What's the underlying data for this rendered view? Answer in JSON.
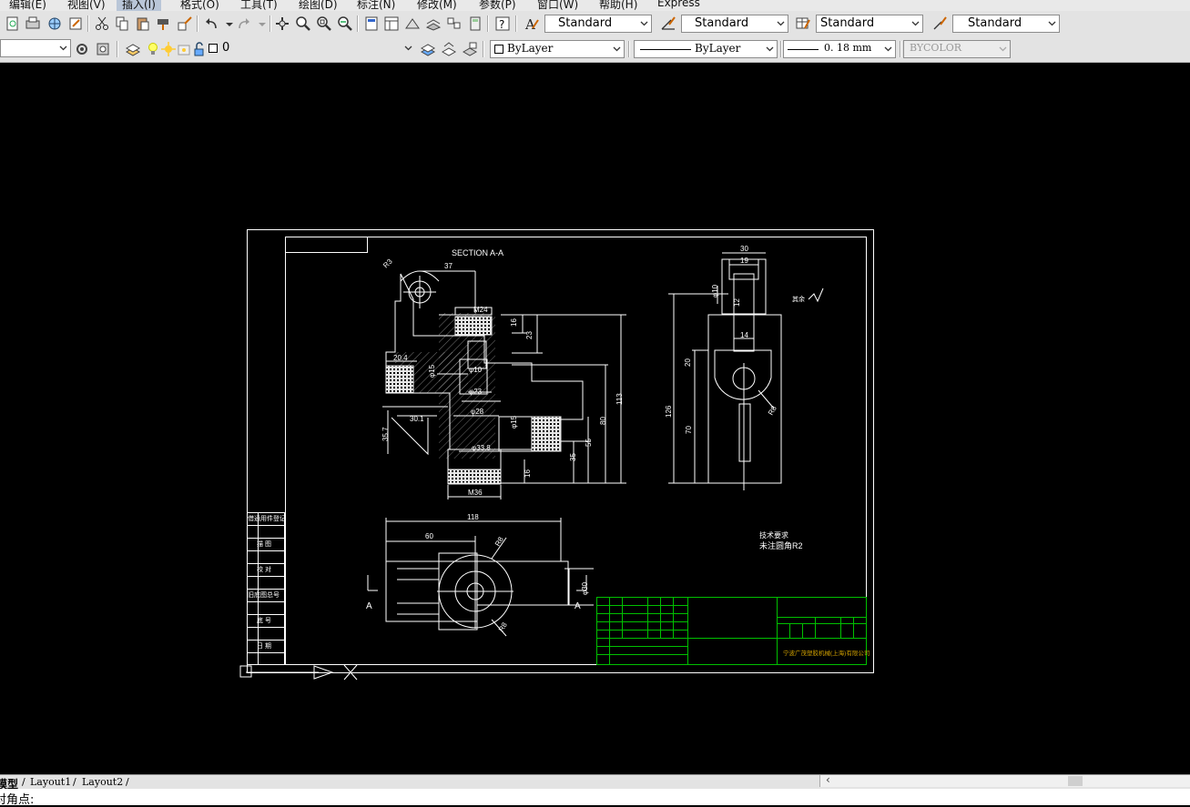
{
  "menu": {
    "items": [
      "编辑(E)",
      "视图(V)",
      "插入(I)",
      "格式(O)",
      "工具(T)",
      "绘图(D)",
      "标注(N)",
      "修改(M)",
      "参数(P)",
      "窗口(W)",
      "帮助(H)",
      "Express"
    ],
    "active": "插入(I)"
  },
  "styles_toolbar": {
    "text_style": "Standard",
    "dim_style": "Standard",
    "table_style": "Standard",
    "multileader_style": "Standard"
  },
  "layers_toolbar": {
    "layer_name": "0",
    "color": "ByLayer",
    "linetype": "ByLayer",
    "lineweight": "0. 18  mm",
    "plot_style": "BYCOLOR"
  },
  "drawing": {
    "section_title": "SECTION A-A",
    "dims_front": [
      "R3",
      "37",
      "M24",
      "16",
      "23",
      "20.4",
      "φ15",
      "φ10",
      "φ23",
      "φ28",
      "30.1",
      "φ15",
      "φ33.8",
      "35.7",
      "M36",
      "16",
      "35",
      "55",
      "80",
      "113"
    ],
    "dims_side": [
      "30",
      "19",
      "φ10",
      "12",
      "14",
      "20",
      "126",
      "70",
      "R8"
    ],
    "dims_top": [
      "118",
      "60",
      "R8",
      "φ30",
      "R8"
    ],
    "section_marks": [
      "A",
      "A"
    ],
    "roughness": "其余",
    "notes": [
      "技术要求",
      "未注圆角R2"
    ],
    "left_panel": [
      "借通用件登记",
      "描 图",
      "校 对",
      "旧底图总号",
      "底 号",
      "日 期"
    ],
    "company": "宁波广茂塑胶机械(上海)有限公司"
  },
  "tabs": {
    "model": "模型",
    "layout1": "Layout1",
    "layout2": "Layout2"
  },
  "command": {
    "prompt": "对角点:"
  },
  "colors": {
    "drawing_bg": "#000000",
    "line": "#ffffff",
    "title_block": "#00c000"
  }
}
